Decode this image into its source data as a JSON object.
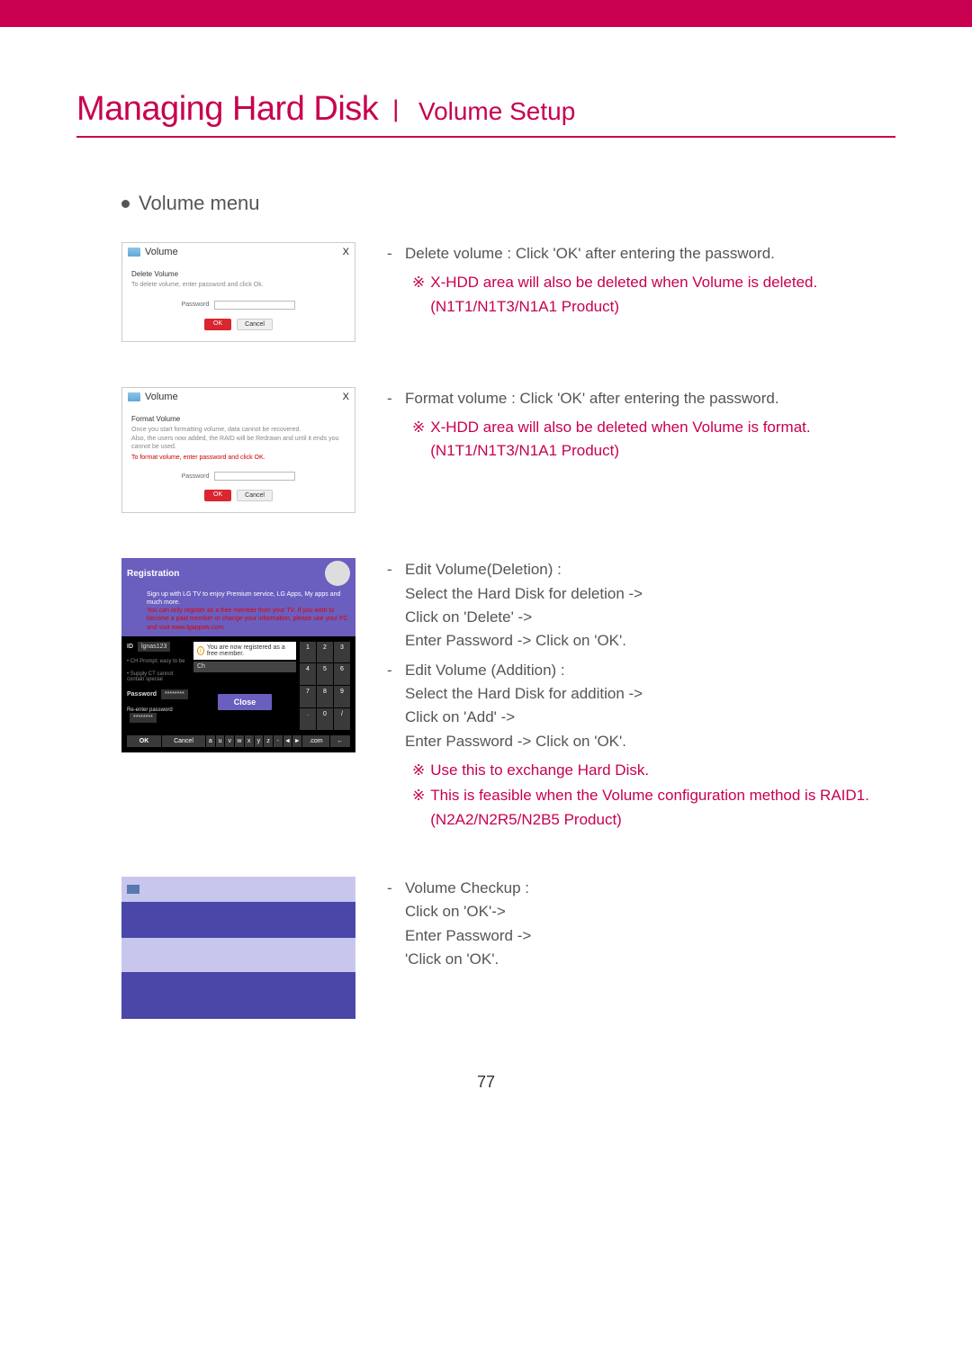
{
  "header": {
    "title_main": "Managing Hard Disk",
    "title_sub": "Volume Setup"
  },
  "section": {
    "label": "Volume menu"
  },
  "shot_common": {
    "window_title": "Volume",
    "pw_label": "Password",
    "btn_ok": "OK",
    "btn_cancel": "Cancel"
  },
  "shot1": {
    "sec_title": "Delete Volume",
    "sec_desc": "To delete volume, enter password and click Ok."
  },
  "shot2": {
    "sec_title": "Format Volume",
    "sec_desc1": "Once you start formatting volume, data cannot be recovered.",
    "sec_desc2": "Also, the users now added, the RAID will be Redrawn and until it ends you cannot be used.",
    "sec_warn": "To format volume, enter password and click OK."
  },
  "reg": {
    "title": "Registration",
    "line1": "Sign up with LG TV to enjoy Premium service, LG Apps, My apps and much more.",
    "line2": "You can only register as a free member from your TV. If you wish to become a paid member or change your information, please use your PC and visit www.lgappstv.com.",
    "id_label": "ID",
    "id_value": "lgnas123",
    "msg": "You are now registered as a free member.",
    "close": "Close",
    "pw_label": "Password",
    "pw_value": "********",
    "repw_label": "Re-enter password",
    "repw_value": "********",
    "ok": "OK",
    "cancel": "Cancel",
    "com": ".com",
    "back": "←",
    "keypad": [
      "1",
      "2",
      "3",
      "4",
      "5",
      "6",
      "7",
      "8",
      "9",
      ".",
      "0",
      "/"
    ],
    "bottom_keys": [
      "a",
      "u",
      "v",
      "w",
      "x",
      "y",
      "z",
      "-",
      "◄",
      "►"
    ]
  },
  "desc": {
    "d1": "Delete volume : Click 'OK' after entering the password.",
    "d1_note": "X-HDD area will also be deleted when Volume is deleted. (N1T1/N1T3/N1A1 Product)",
    "d2": "Format volume : Click 'OK' after entering the password.",
    "d2_note": "X-HDD area will also be deleted when Volume is format. (N1T1/N1T3/N1A1 Product)",
    "d3a": "Edit Volume(Deletion) :",
    "d3b": "Select the Hard Disk for deletion ->",
    "d3c": "Click on 'Delete' ->",
    "d3d": "Enter Password ->  Click on 'OK'.",
    "d4a": "Edit Volume (Addition) :",
    "d4b": "Select the Hard Disk for addition ->",
    "d4c": "Click on 'Add' ->",
    "d4d": "Enter Password -> Click on 'OK'.",
    "d4_note1": "Use this to exchange Hard Disk.",
    "d4_note2": "This is feasible when the Volume configuration method is RAID1. (N2A2/N2R5/N2B5 Product)",
    "d5a": "Volume Checkup :",
    "d5b": "Click on 'OK'->",
    "d5c": "Enter Password ->",
    "d5d": "'Click on 'OK'."
  },
  "footer": {
    "page": "77"
  }
}
